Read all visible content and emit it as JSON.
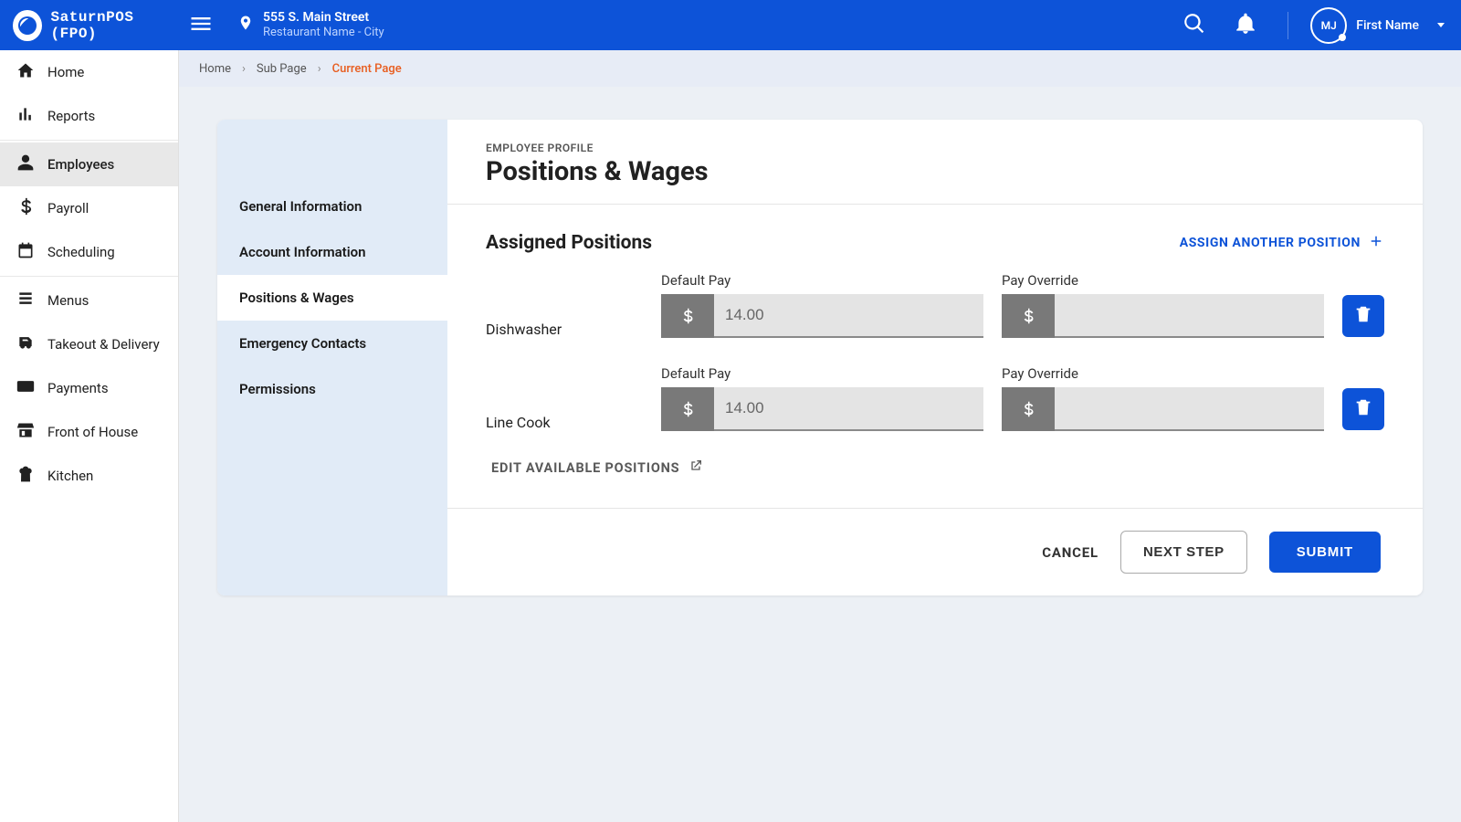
{
  "app": {
    "name": "SaturnPOS (FPO)"
  },
  "location": {
    "line1": "555 S. Main Street",
    "line2": "Restaurant Name - City"
  },
  "user": {
    "initials": "MJ",
    "display_name": "First Name"
  },
  "sidebar": {
    "items": [
      {
        "id": "home",
        "label": "Home"
      },
      {
        "id": "reports",
        "label": "Reports"
      },
      {
        "id": "employees",
        "label": "Employees"
      },
      {
        "id": "payroll",
        "label": "Payroll"
      },
      {
        "id": "scheduling",
        "label": "Scheduling"
      },
      {
        "id": "menus",
        "label": "Menus"
      },
      {
        "id": "takeout",
        "label": "Takeout & Delivery"
      },
      {
        "id": "payments",
        "label": "Payments"
      },
      {
        "id": "foh",
        "label": "Front of House"
      },
      {
        "id": "kitchen",
        "label": "Kitchen"
      }
    ],
    "active_id": "employees"
  },
  "breadcrumb": {
    "home": "Home",
    "sub": "Sub Page",
    "current": "Current Page"
  },
  "sub_tabs": [
    {
      "label": "General Information"
    },
    {
      "label": "Account Information"
    },
    {
      "label": "Positions & Wages",
      "active": true
    },
    {
      "label": "Emergency Contacts"
    },
    {
      "label": "Permissions"
    }
  ],
  "profile": {
    "eyebrow": "EMPLOYEE PROFILE",
    "title": "Positions & Wages"
  },
  "assigned": {
    "heading": "Assigned Positions",
    "assign_link": "ASSIGN ANOTHER POSITION",
    "labels": {
      "default_pay": "Default Pay",
      "pay_override": "Pay Override"
    },
    "positions": [
      {
        "name": "Dishwasher",
        "default_pay": "14.00",
        "override": ""
      },
      {
        "name": "Line Cook",
        "default_pay": "14.00",
        "override": ""
      }
    ],
    "edit_link": "EDIT AVAILABLE POSITIONS"
  },
  "footer": {
    "cancel": "CANCEL",
    "next": "NEXT STEP",
    "submit": "SUBMIT"
  }
}
